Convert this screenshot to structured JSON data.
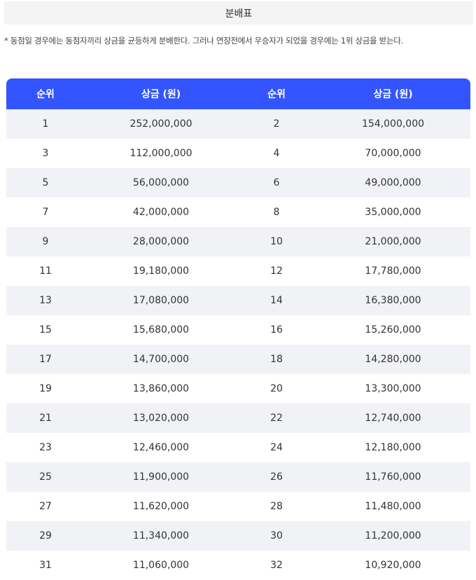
{
  "title": "분배표",
  "note": "* 동점일 경우에는 동점자끼리 상금을 균등하게 분배한다. 그러나 연장전에서 우승자가 되었을 경우에는 1위 상금을 받는다.",
  "table": {
    "headers": [
      "순위",
      "상금 (원)",
      "순위",
      "상금 (원)"
    ],
    "rows": [
      [
        "1",
        "252,000,000",
        "2",
        "154,000,000"
      ],
      [
        "3",
        "112,000,000",
        "4",
        "70,000,000"
      ],
      [
        "5",
        "56,000,000",
        "6",
        "49,000,000"
      ],
      [
        "7",
        "42,000,000",
        "8",
        "35,000,000"
      ],
      [
        "9",
        "28,000,000",
        "10",
        "21,000,000"
      ],
      [
        "11",
        "19,180,000",
        "12",
        "17,780,000"
      ],
      [
        "13",
        "17,080,000",
        "14",
        "16,380,000"
      ],
      [
        "15",
        "15,680,000",
        "16",
        "15,260,000"
      ],
      [
        "17",
        "14,700,000",
        "18",
        "14,280,000"
      ],
      [
        "19",
        "13,860,000",
        "20",
        "13,300,000"
      ],
      [
        "21",
        "13,020,000",
        "22",
        "12,740,000"
      ],
      [
        "23",
        "12,460,000",
        "24",
        "12,180,000"
      ],
      [
        "25",
        "11,900,000",
        "26",
        "11,760,000"
      ],
      [
        "27",
        "11,620,000",
        "28",
        "11,480,000"
      ],
      [
        "29",
        "11,340,000",
        "30",
        "11,200,000"
      ],
      [
        "31",
        "11,060,000",
        "32",
        "10,920,000"
      ]
    ]
  },
  "colors": {
    "header_bg": "#3355ff",
    "row_alt_bg": "#f1f2f6",
    "title_bg": "#f4f4f5"
  }
}
